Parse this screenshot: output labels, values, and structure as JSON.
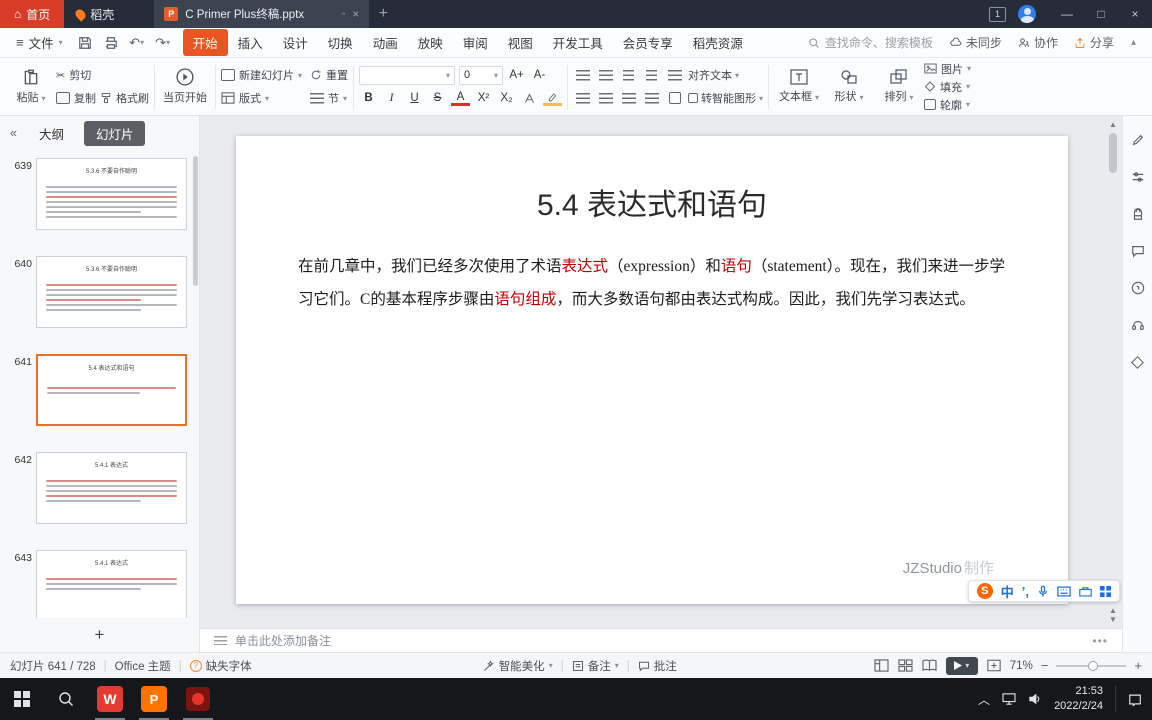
{
  "titlebar": {
    "home": "首页",
    "docer": "稻壳",
    "doc_tab": "C Primer Plus终稿.pptx",
    "upload_badge": "1",
    "minimize": "—",
    "maximize": "□",
    "close": "×"
  },
  "menubar": {
    "file": "文件",
    "undo": "↶",
    "redo": "↷",
    "tabs": [
      "开始",
      "插入",
      "设计",
      "切换",
      "动画",
      "放映",
      "审阅",
      "视图",
      "开发工具",
      "会员专享",
      "稻壳资源"
    ],
    "active_tab": "开始",
    "search": "查找命令、搜索模板",
    "sync": "未同步",
    "collab": "协作",
    "share": "分享"
  },
  "toolbar": {
    "paste": "粘贴",
    "cut": "剪切",
    "copy": "复制",
    "painter": "格式刷",
    "play_current": "当页开始",
    "new_slide": "新建幻灯片",
    "layout": "版式",
    "reset": "重置",
    "section": "节",
    "font_size": "0",
    "font_grow": "A+",
    "font_shrink": "A-",
    "bold": "B",
    "italic": "I",
    "underline": "U",
    "strike": "S",
    "font_color": "A",
    "sup": "X²",
    "sub": "X₂",
    "align_text": "对齐文本",
    "smartart": "转智能图形",
    "textbox": "文本框",
    "shapes": "形状",
    "arrange": "排列",
    "picture": "图片",
    "fill": "填充",
    "outline": "轮廓"
  },
  "sidebar": {
    "outline_tab": "大纲",
    "slides_tab": "幻灯片",
    "add_slide": "+",
    "slides": [
      {
        "num": "639",
        "title": "5.3.6 不要自作聪明",
        "selected": false
      },
      {
        "num": "640",
        "title": "5.3.6 不要自作聪明",
        "selected": false
      },
      {
        "num": "641",
        "title": "5.4 表达式和语句",
        "selected": true
      },
      {
        "num": "642",
        "title": "5.4.1 表达式",
        "selected": false
      },
      {
        "num": "643",
        "title": "5.4.1 表达式",
        "selected": false
      }
    ]
  },
  "slide": {
    "title": "5.4 表达式和语句",
    "body": [
      {
        "text": "在前几章中，我们已经多次使用了术语",
        "red": false
      },
      {
        "text": "表达式",
        "red": true
      },
      {
        "text": "（expression）和",
        "red": false
      },
      {
        "text": "语句",
        "red": true
      },
      {
        "text": "（statement）。现在，我们来进一步学习它们。C的基本程序步骤由",
        "red": false
      },
      {
        "text": "语句组成",
        "red": true
      },
      {
        "text": "，而大多数语句都由表达式构成。因此，我们先学习表达式。",
        "red": false
      }
    ],
    "watermark_a": "JZStudio",
    "watermark_b": "制作"
  },
  "notes": {
    "placeholder": "单击此处添加备注"
  },
  "statusbar": {
    "slide_counter": "幻灯片 641 / 728",
    "theme": "Office 主题",
    "missing_fonts": "缺失字体",
    "beautify": "智能美化",
    "notes": "备注",
    "comments": "批注",
    "zoom": "71%"
  },
  "ime": {
    "mode": "中"
  },
  "taskbar": {
    "time": "21:53",
    "date": "2022/2/24"
  },
  "colors": {
    "accent_orange": "#ea5420",
    "slide_red_text": "#c00000",
    "selected_thumb_border": "#e8702a",
    "titlebar_bg": "#272d38",
    "home_button_red": "#d83b26",
    "taskbar_bg": "#16171a",
    "ime_blue": "#1d6fe0",
    "sogou_orange": "#ff6600"
  }
}
